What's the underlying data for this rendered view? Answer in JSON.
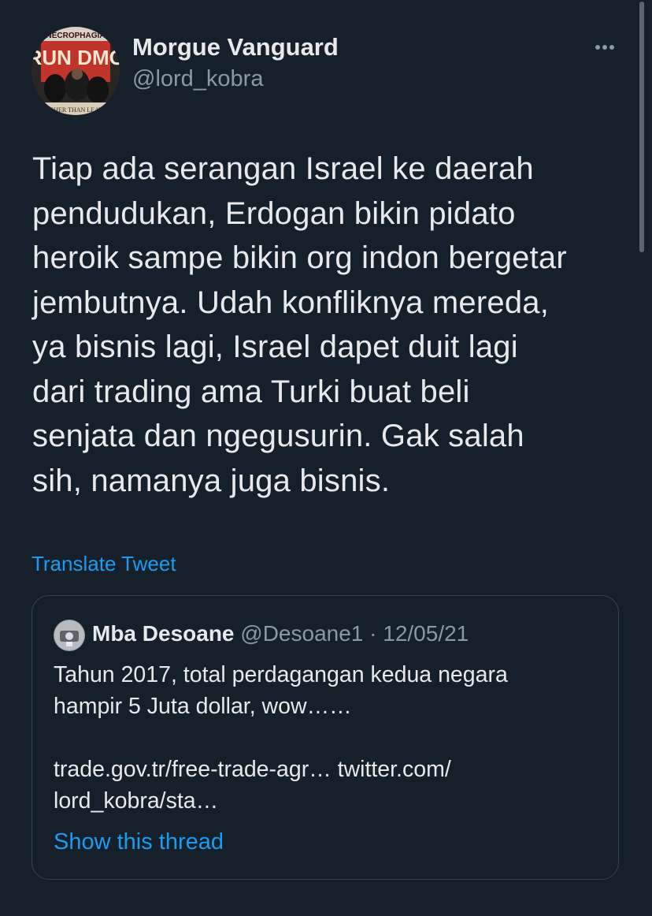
{
  "tweet": {
    "author": {
      "display_name": "Morgue Vanguard",
      "handle": "@lord_kobra",
      "avatar_icon": "album-cover-avatar"
    },
    "more_icon": "more-horizontal-icon",
    "text_lines": [
      "Tiap ada serangan Israel ke daerah",
      "pendudukan, Erdogan bikin pidato",
      "heroik sampe bikin org indon bergetar",
      "jembutnya. Udah konfliknya mereda,",
      "ya bisnis lagi, Israel dapet duit lagi",
      "dari trading ama Turki buat beli",
      "senjata dan ngegusurin. Gak salah",
      "sih, namanya juga bisnis."
    ],
    "translate_label": "Translate Tweet"
  },
  "quoted": {
    "display_name": "Mba Desoane",
    "handle": "@Desoane1",
    "separator": "·",
    "date": "12/05/21",
    "text_lines": [
      "Tahun 2017, total perdagangan kedua negara",
      "hampir 5 Juta dollar, wow……",
      "",
      "trade.gov.tr/free-trade-agr… twitter.com/",
      "lord_kobra/sta…"
    ],
    "show_thread_label": "Show this thread"
  },
  "colors": {
    "background": "#15202b",
    "text": "#e7e9ea",
    "secondary": "#8b98a5",
    "link": "#1d9bf0",
    "border": "#38444d"
  },
  "avatar_text": {
    "top_banner": "NECROPHAGIA",
    "main": "RUN DMC",
    "bottom": "TOUGHER THAN LEATHER"
  }
}
